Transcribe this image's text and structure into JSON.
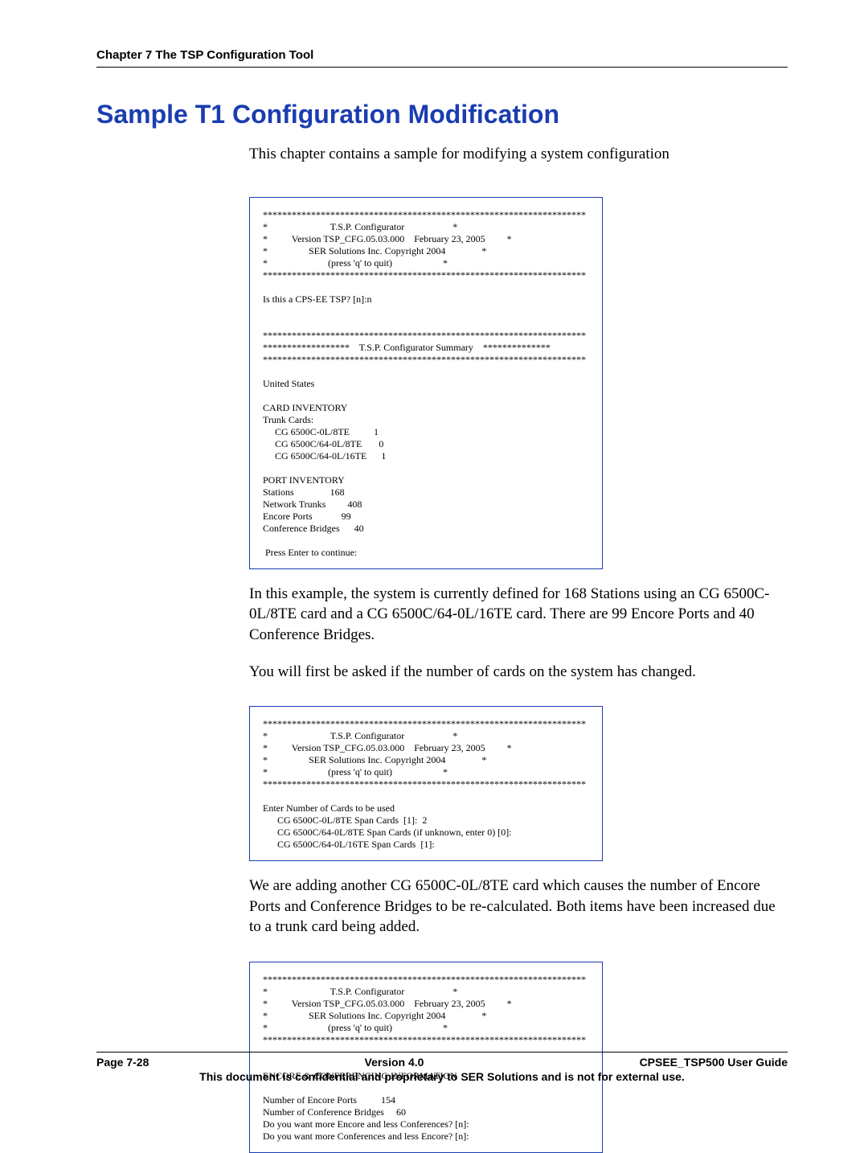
{
  "chapter_header": "Chapter 7 The TSP Configuration Tool",
  "heading": "Sample T1 Configuration Modification",
  "intro": "This chapter contains a sample for modifying a system configuration",
  "screenshot1": "*******************************************************************\n*                          T.S.P. Configurator                    *\n*          Version TSP_CFG.05.03.000    February 23, 2005         *\n*                 SER Solutions Inc. Copyright 2004               *\n*                         (press 'q' to quit)                     *\n*******************************************************************\n\nIs this a CPS-EE TSP? [n]:n\n\n\n*******************************************************************\n******************    T.S.P. Configurator Summary    **************\n*******************************************************************\n\nUnited States\n\nCARD INVENTORY\nTrunk Cards:\n     CG 6500C-0L/8TE          1\n     CG 6500C/64-0L/8TE       0\n     CG 6500C/64-0L/16TE      1\n\nPORT INVENTORY\nStations               168\nNetwork Trunks         408\nEncore Ports            99\nConference Bridges      40\n\n Press Enter to continue:",
  "para1": "In this example, the system is currently defined for 168 Stations using an CG 6500C-0L/8TE card and a CG 6500C/64-0L/16TE card. There are 99 Encore Ports and 40 Conference Bridges.",
  "para2": "You will first be asked if the number of cards on the system has changed.",
  "screenshot2": "*******************************************************************\n*                          T.S.P. Configurator                    *\n*          Version TSP_CFG.05.03.000    February 23, 2005         *\n*                 SER Solutions Inc. Copyright 2004               *\n*                         (press 'q' to quit)                     *\n*******************************************************************\n\nEnter Number of Cards to be used\n      CG 6500C-0L/8TE Span Cards  [1]:  2\n      CG 6500C/64-0L/8TE Span Cards (if unknown, enter 0) [0]:\n      CG 6500C/64-0L/16TE Span Cards  [1]:",
  "para3": "We are adding another CG 6500C-0L/8TE card which causes the number of Encore Ports and Conference Bridges to be re-calculated.  Both items have been increased due to a trunk card being added.",
  "screenshot3": "*******************************************************************\n*                          T.S.P. Configurator                    *\n*          Version TSP_CFG.05.03.000    February 23, 2005         *\n*                 SER Solutions Inc. Copyright 2004               *\n*                         (press 'q' to quit)                     *\n*******************************************************************\n\n\nENCORE & CONFERENCING INFORMATION\n\nNumber of Encore Ports          154\nNumber of Conference Bridges     60\nDo you want more Encore and less Conferences? [n]:\nDo you want more Conferences and less Encore? [n]:",
  "footer": {
    "left": "Page 7-28",
    "center": "Version 4.0",
    "right": "CPSEE_TSP500 User Guide",
    "notice": "This document is confidential and proprietary to SER Solutions and is not for external use."
  }
}
